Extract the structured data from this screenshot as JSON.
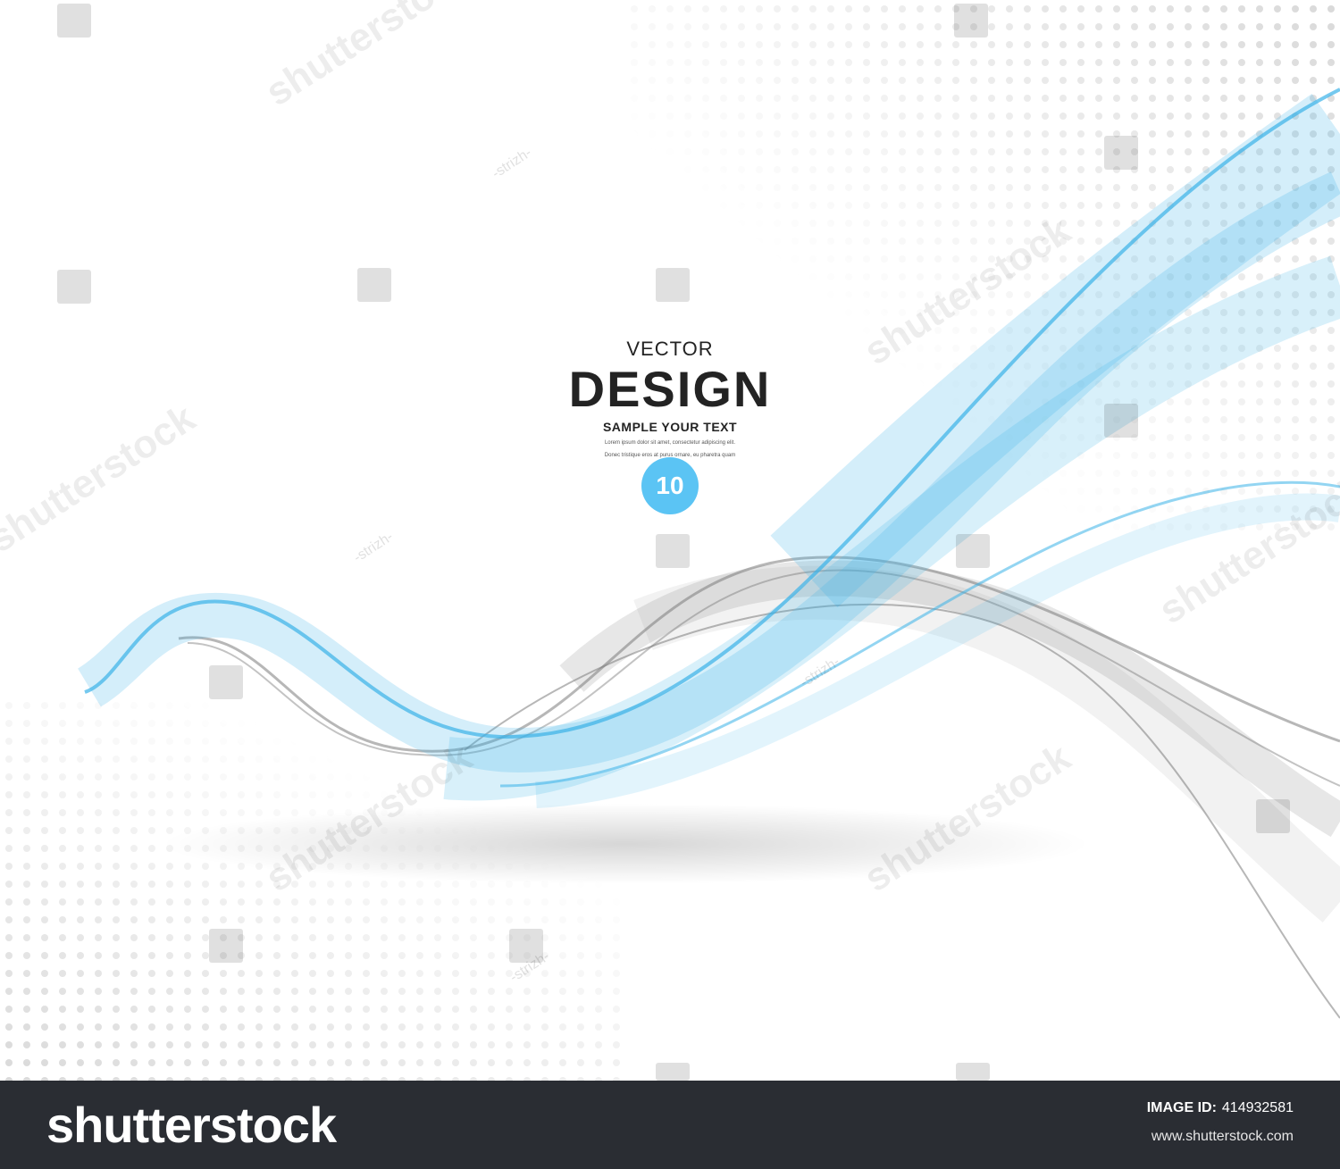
{
  "artwork": {
    "top_label": "VECTOR",
    "headline": "DESIGN",
    "subheadline": "SAMPLE YOUR TEXT",
    "body_line_1": "Lorem ipsum dolor sit amet, consectetur adipiscing elit.",
    "body_line_2": "Donec tristique eros at purus ornare, eu pharetra quam",
    "badge": "10",
    "colors": {
      "blue_wave": "#3ab2e8",
      "gray_wave": "#7b7b7b",
      "badge": "#5bc4f4",
      "halftone": "#d9d9d9"
    }
  },
  "watermark": {
    "brand": "shutterstock",
    "author": "-strizh-"
  },
  "footer": {
    "brand": "shutterstock",
    "image_id_label": "IMAGE ID:",
    "image_id": "414932581",
    "site": "www.shutterstock.com"
  }
}
